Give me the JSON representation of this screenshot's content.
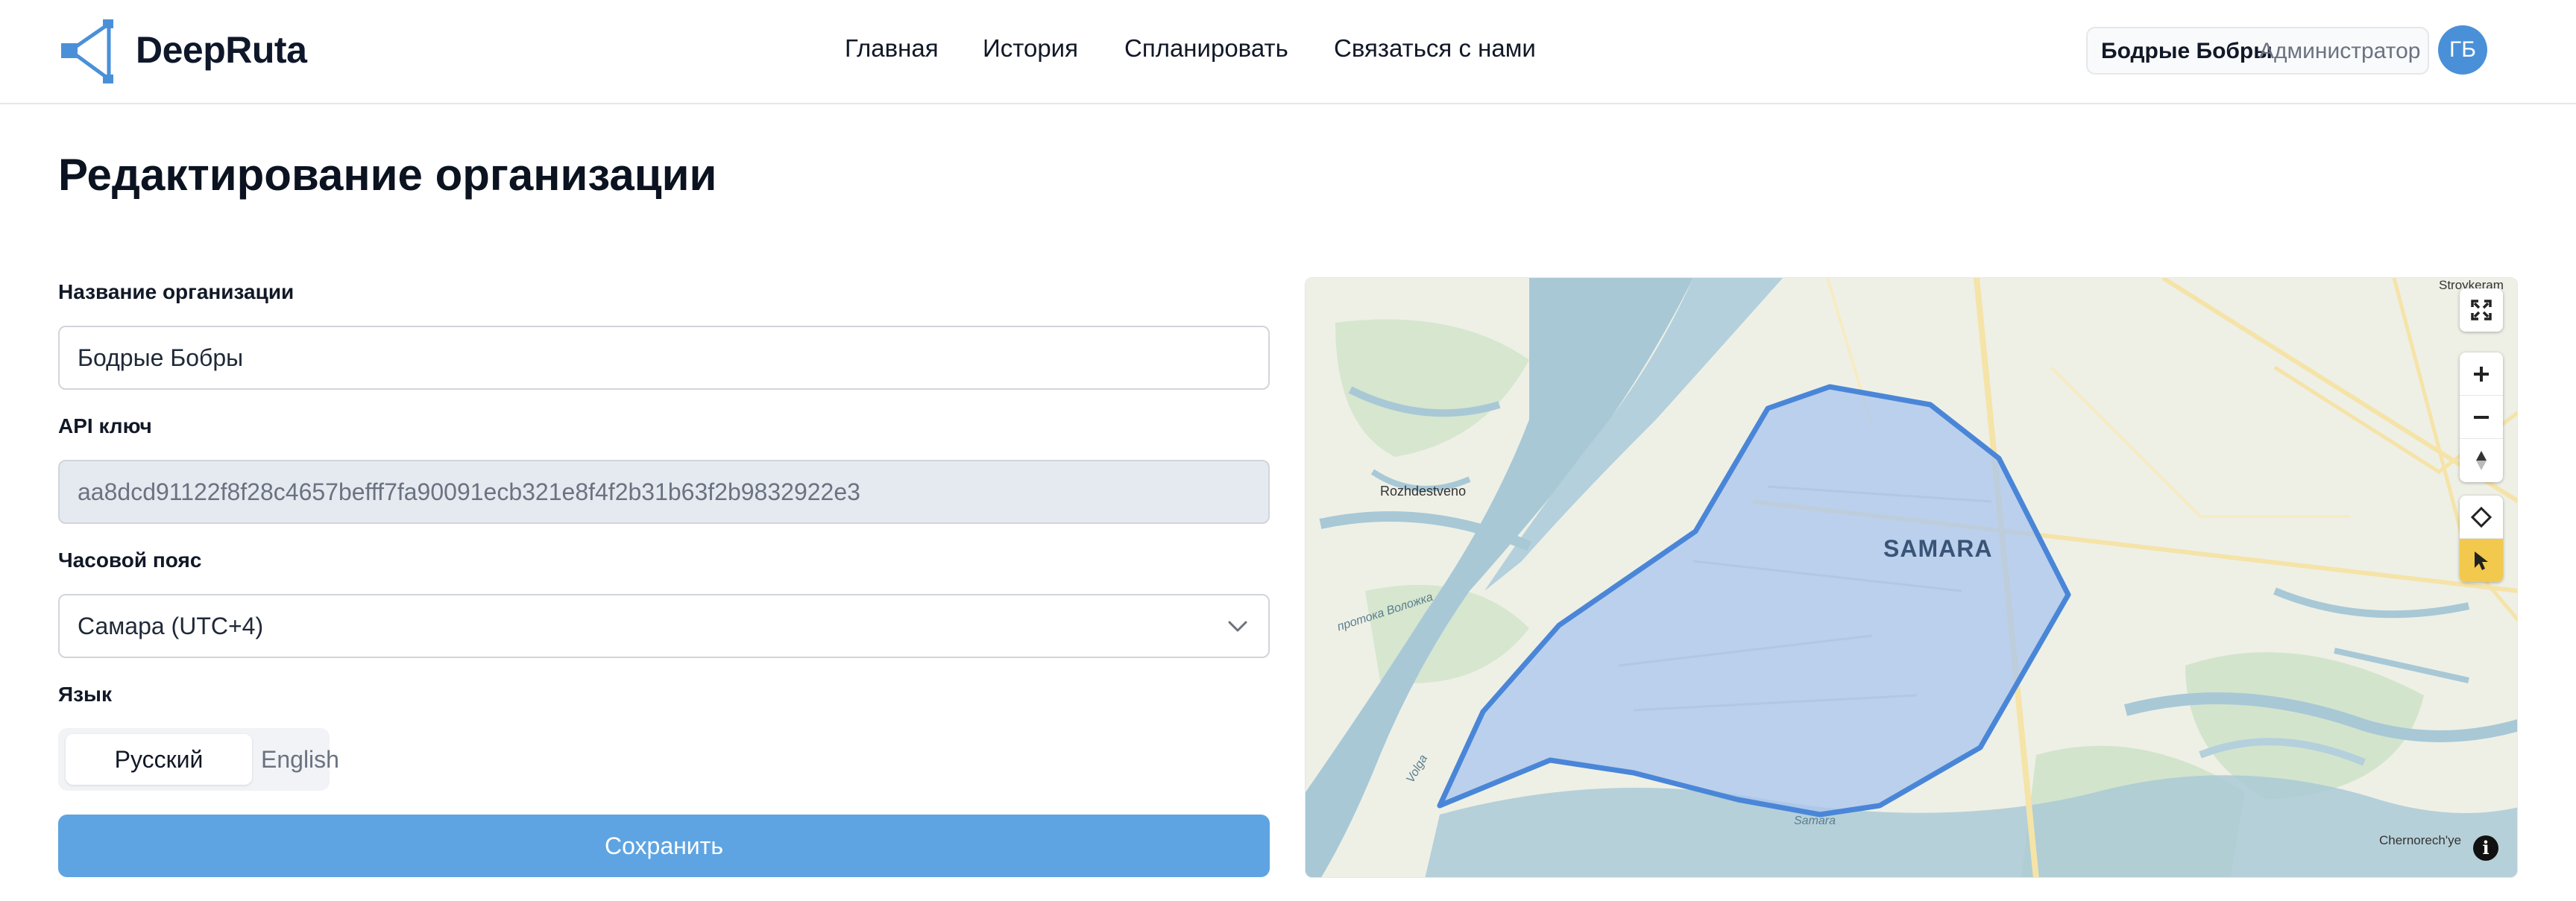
{
  "brand": {
    "name": "DeepRuta"
  },
  "nav": {
    "items": [
      {
        "label": "Главная"
      },
      {
        "label": "История"
      },
      {
        "label": "Спланировать"
      },
      {
        "label": "Связаться с нами"
      }
    ]
  },
  "user": {
    "org_name": "Бодрые Бобры",
    "role": "Администратор",
    "initials": "ГБ"
  },
  "page": {
    "title": "Редактирование организации"
  },
  "form": {
    "org_name_label": "Название организации",
    "org_name_value": "Бодрые Бобры",
    "api_key_label": "API ключ",
    "api_key_value": "aa8dcd91122f8f28c4657befff7fa90091ecb321e8f4f2b31b63f2b9832922e3",
    "timezone_label": "Часовой пояс",
    "timezone_value": "Самара (UTC+4)",
    "language_label": "Язык",
    "language_options": [
      "Русский",
      "English"
    ],
    "language_selected": "Русский",
    "save_label": "Сохранить"
  },
  "map": {
    "city_label": "SAMARA",
    "place_labels": [
      "Rozhdestveno",
      "Stroykeram",
      "Chernorech'ye",
      "Samara",
      "Volga",
      "протока Воложка"
    ],
    "controls": [
      "fullscreen-icon",
      "zoom-in-icon",
      "zoom-out-icon",
      "compass-icon",
      "polygon-draw-icon",
      "pointer-select-icon"
    ],
    "colors": {
      "polygon_fill": "#a9c6ee",
      "polygon_stroke": "#4a86d8",
      "water": "#a8c8d6",
      "land": "#eef0e6",
      "active_tool": "#f2c94c"
    }
  }
}
